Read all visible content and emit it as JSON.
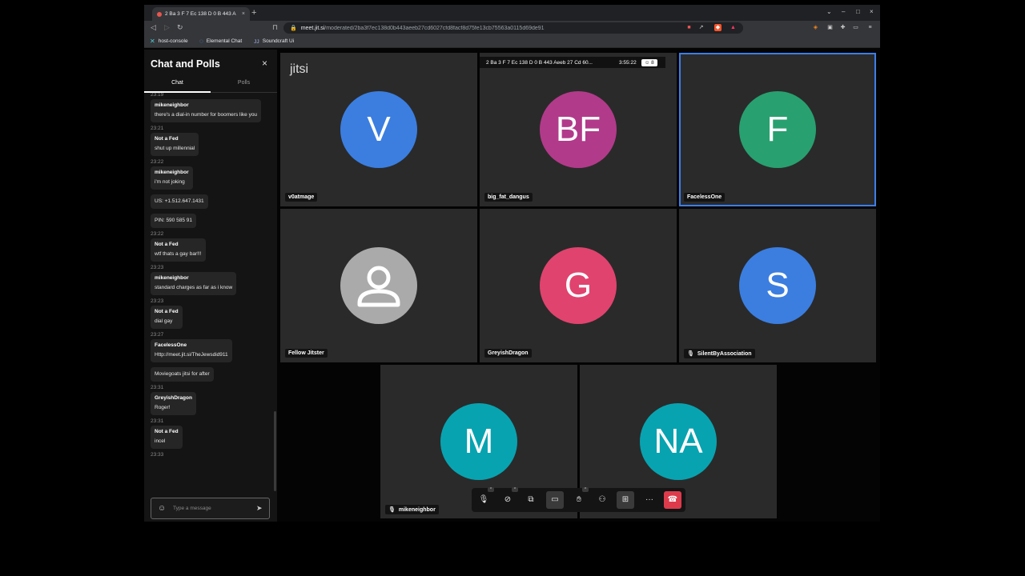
{
  "browser": {
    "tab_title": "2 Ba 3 F 7 Ec 138 D 0 B 443 A",
    "tab_close": "×",
    "new_tab": "+",
    "url_host": "meet.jit.si",
    "url_path": "/moderated/2ba3f7ec138d0b443aeeb27cd6027cfd8facf8d75fe13cb75563a0115d69de91",
    "win_min": "⌄",
    "win_minimize": "–",
    "win_max": "□",
    "win_close": "×",
    "bookmarks": [
      {
        "icon": "✕",
        "label": "host-console"
      },
      {
        "icon": "◌",
        "label": "Elemental Chat"
      },
      {
        "icon": "ᴊᴊ",
        "label": "Soundcraft Ui"
      }
    ]
  },
  "chat": {
    "title": "Chat and Polls",
    "close": "×",
    "tabs": [
      "Chat",
      "Polls"
    ],
    "messages": [
      {
        "ts": "23:19"
      },
      {
        "sender": "mikeneighbor",
        "text": "there's a dial-in number for boomers like you"
      },
      {
        "ts": "23:21"
      },
      {
        "sender": "Not a Fed",
        "text": "shut up millennial"
      },
      {
        "ts": "23:22"
      },
      {
        "sender": "mikeneighbor",
        "text": "i'm not joking"
      },
      {
        "text": "US:  +1.512.647.1431"
      },
      {
        "text": "PIN: 590 585 91"
      },
      {
        "ts": "23:22"
      },
      {
        "sender": "Not a Fed",
        "text": "wtf thats a gay bar!!!"
      },
      {
        "ts": "23:23"
      },
      {
        "sender": "mikeneighbor",
        "text": "standard charges as far as i know"
      },
      {
        "ts": "23:23"
      },
      {
        "sender": "Not a Fed",
        "text": "dial gay"
      },
      {
        "ts": "23:27"
      },
      {
        "sender": "FacelessOne",
        "text": "Http://meet.jit.si/TheJewsdid911"
      },
      {
        "text": "Moviegoats jitsi for after"
      },
      {
        "ts": "23:31"
      },
      {
        "sender": "GreyishDragon",
        "text": "Roger!"
      },
      {
        "ts": "23:31"
      },
      {
        "sender": "Not a Fed",
        "text": "incel"
      },
      {
        "ts": "23:33"
      }
    ],
    "input_placeholder": "Type a message"
  },
  "stage": {
    "logo": "jitsi",
    "room_name": "2 Ba 3 F 7 Ec 138 D 0 B 443 Aeeb 27 Cd 60...",
    "timer": "3:55:22",
    "participant_count": "8",
    "tiles": [
      {
        "name": "v0atmage",
        "initials": "V",
        "color": "#3b7ee0"
      },
      {
        "name": "big_fat_dangus",
        "initials": "BF",
        "color": "#b23a8a"
      },
      {
        "name": "FacelessOne",
        "initials": "F",
        "color": "#28a06f"
      },
      {
        "name": "Fellow Jitster",
        "initials": "",
        "color": "#aaaaaa"
      },
      {
        "name": "GreyishDragon",
        "initials": "G",
        "color": "#e0436e"
      },
      {
        "name": "SilentByAssociation",
        "initials": "S",
        "color": "#3b7ee0"
      },
      {
        "name": "mikeneighbor",
        "initials": "M",
        "color": "#08a3b0"
      },
      {
        "name": "",
        "initials": "NA",
        "color": "#08a3b0"
      }
    ]
  }
}
